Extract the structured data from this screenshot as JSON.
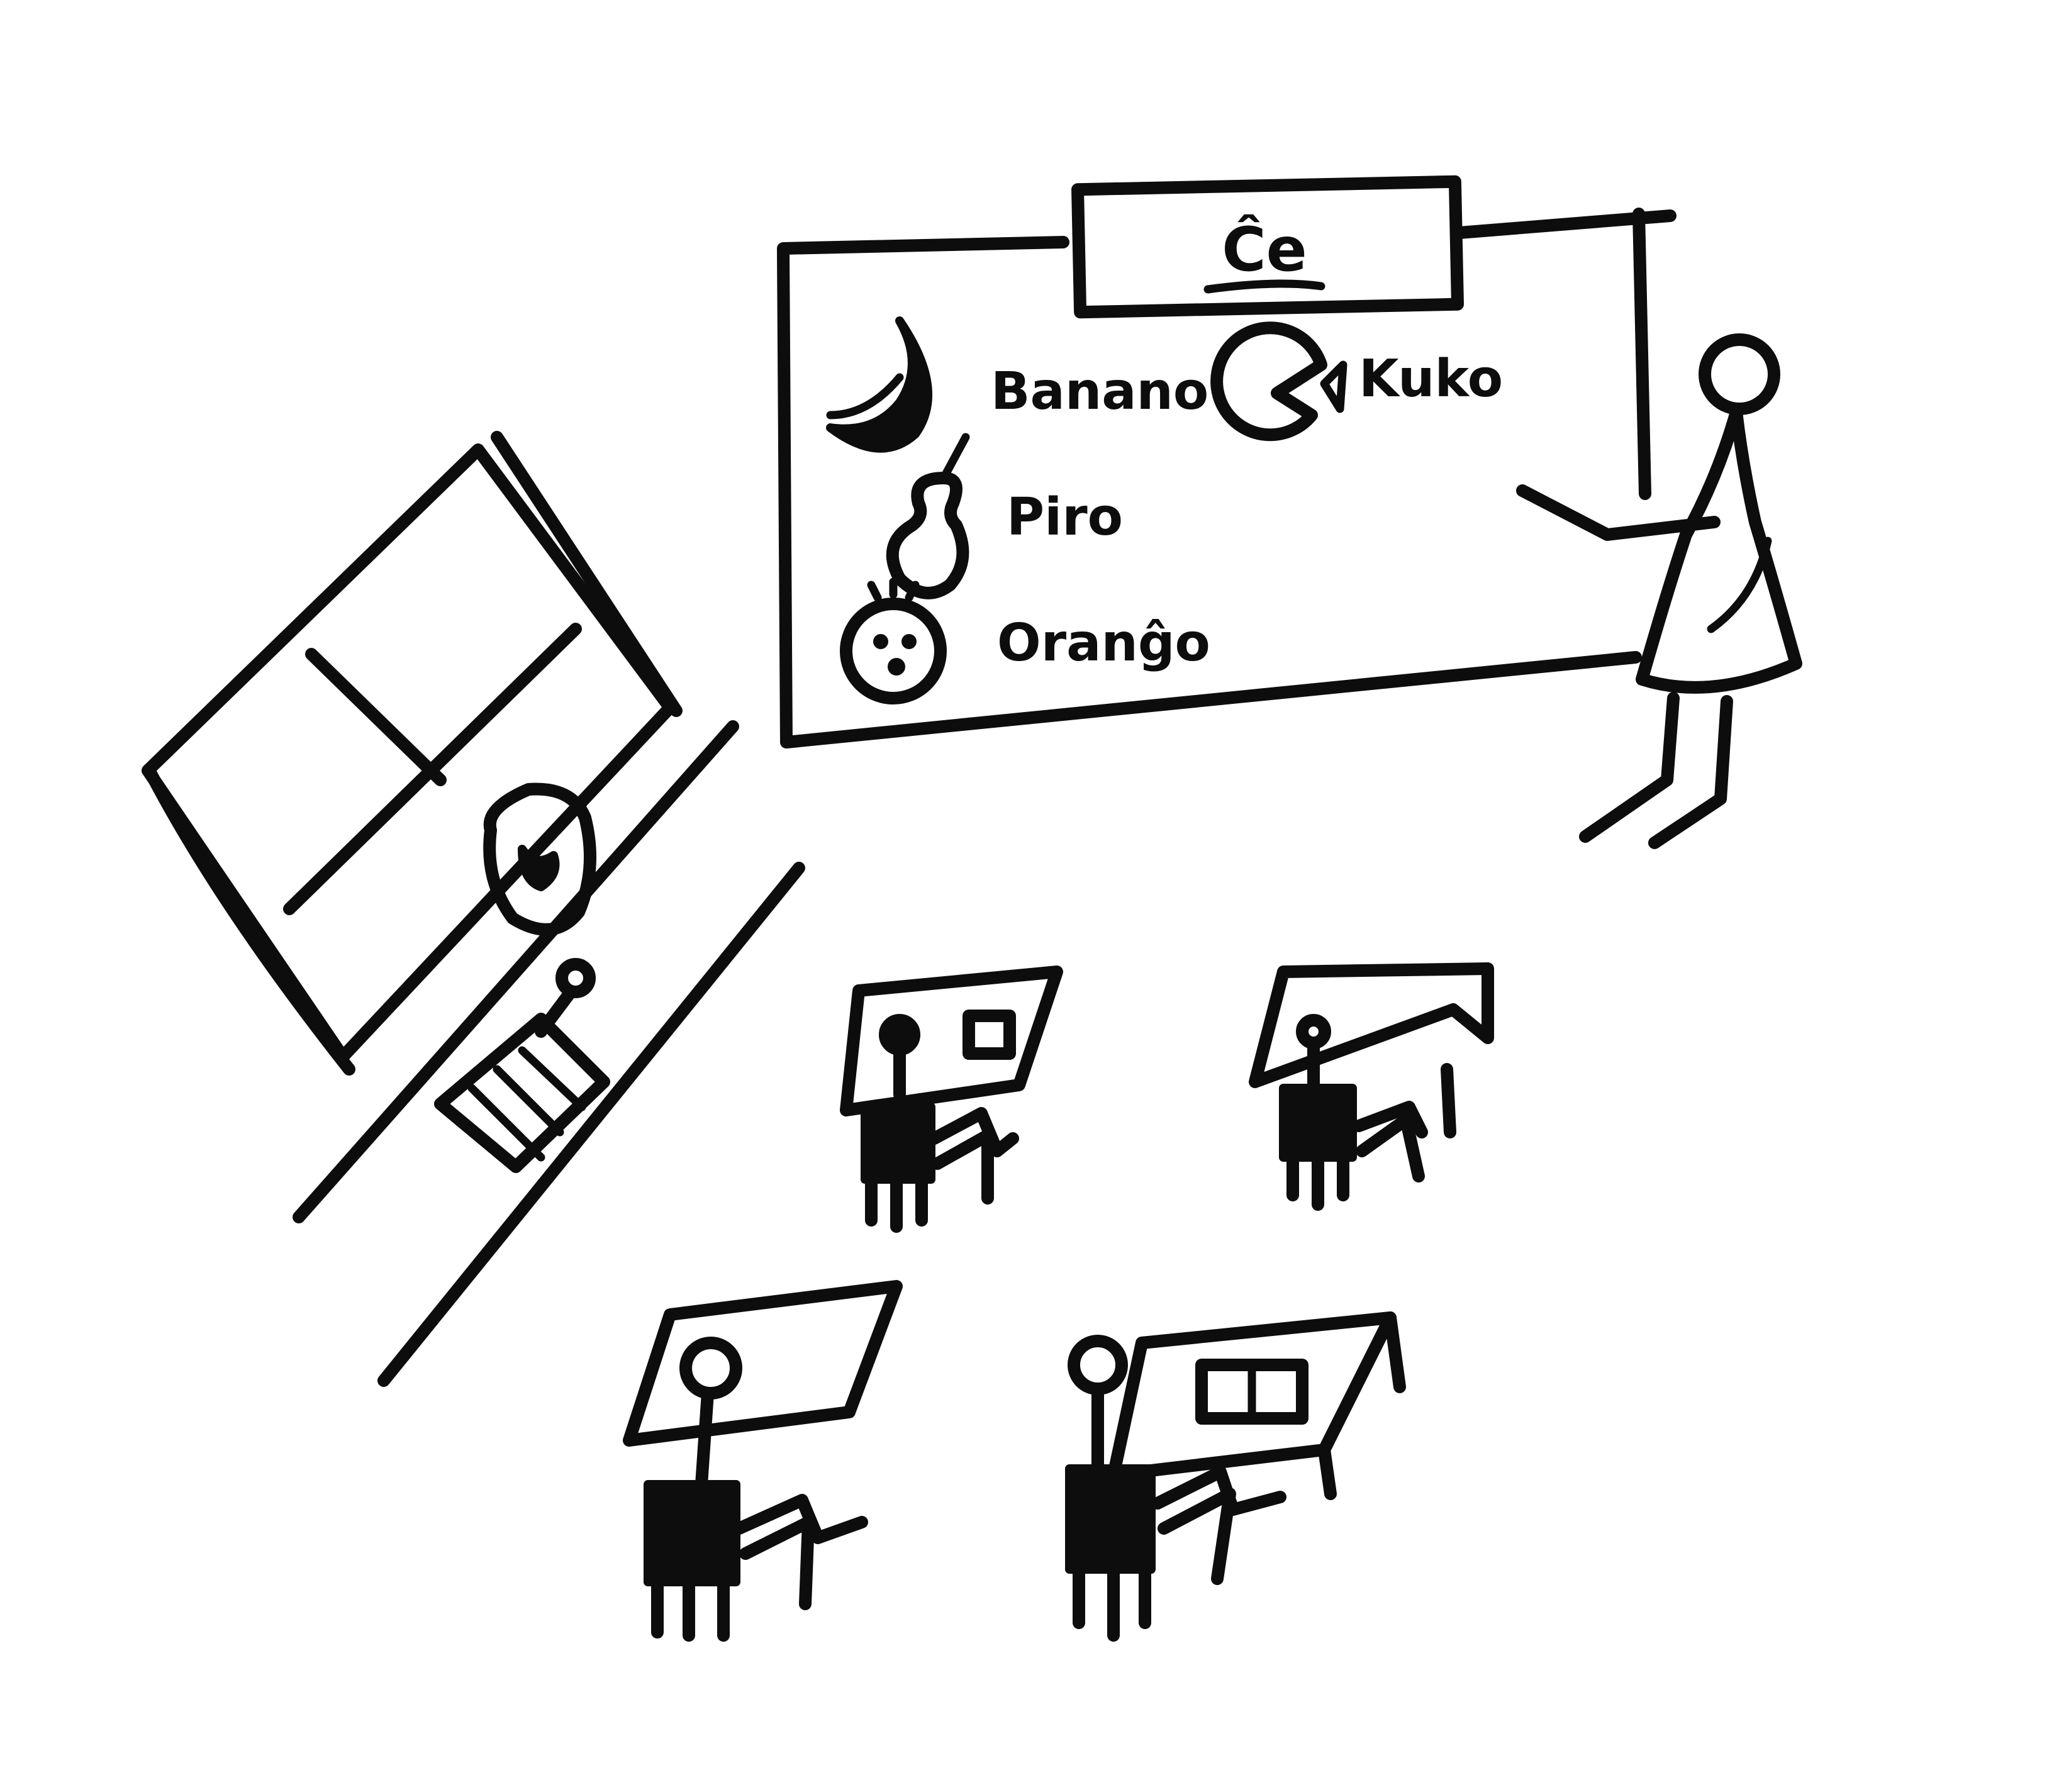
{
  "board": {
    "title": "Ĉe",
    "words": [
      "Banano",
      "Kuko",
      "Piro",
      "Oranĝo"
    ]
  },
  "icons": [
    "banana-icon",
    "cake-slice-icon",
    "pear-icon",
    "orange-face-icon"
  ],
  "colors": {
    "ink": "#0d0d0d",
    "paper": "#ffffff"
  }
}
